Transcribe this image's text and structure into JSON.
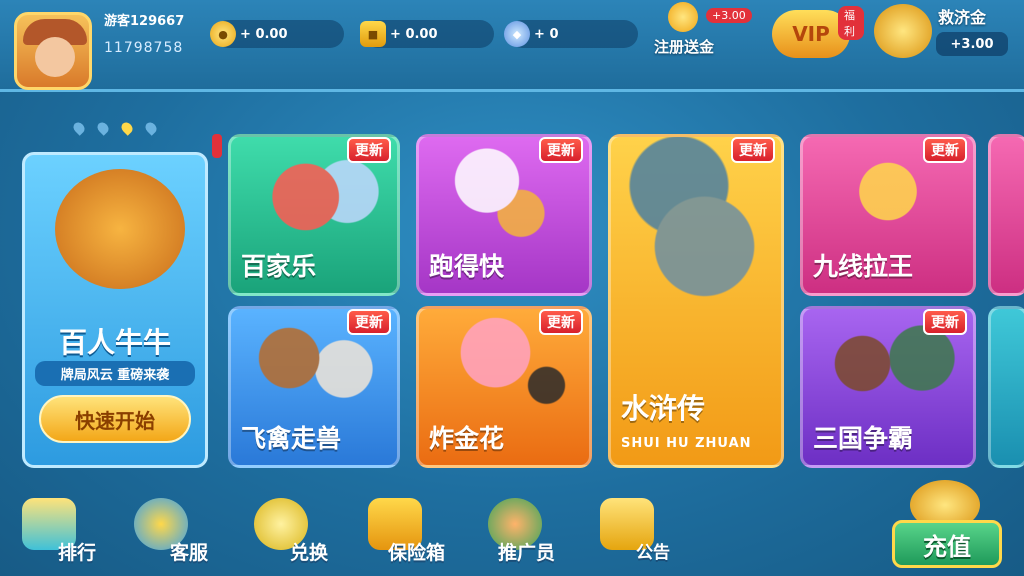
{
  "user": {
    "name": "游客129667",
    "id": "11798758"
  },
  "currency": [
    {
      "icon": "gold-coin-icon",
      "prefix": "+",
      "value": "0.00"
    },
    {
      "icon": "gold-box-icon",
      "prefix": "+",
      "value": "0.00"
    },
    {
      "icon": "gem-icon",
      "prefix": "+",
      "value": "0"
    }
  ],
  "register_gift": {
    "label": "注册送金",
    "badge": "+3.00"
  },
  "vip": {
    "label": "VIP",
    "badge": "福利"
  },
  "relief": {
    "label": "救济金",
    "amount": "+3.00"
  },
  "featured": {
    "title": "百人牛牛",
    "subtitle": "牌局风云 重磅来袭",
    "button": "快速开始"
  },
  "update_badge": "更新",
  "games": [
    {
      "name": "百家乐",
      "color": "#2ec79a"
    },
    {
      "name": "跑得快",
      "color": "#c84bd8"
    },
    {
      "name": "水浒传",
      "sub": "SHUI HU ZHUAN",
      "color": "#f2b127"
    },
    {
      "name": "九线拉王",
      "color": "#e44b9c"
    },
    {
      "name": "飞禽走兽",
      "color": "#3b8ee6"
    },
    {
      "name": "炸金花",
      "color": "#f28a1e"
    },
    {
      "name": "三国争霸",
      "color": "#8d4ad8"
    }
  ],
  "nav": [
    {
      "label": "排行",
      "icon": "podium-icon"
    },
    {
      "label": "客服",
      "icon": "headset-icon"
    },
    {
      "label": "兑换",
      "icon": "exchange-icon"
    },
    {
      "label": "保险箱",
      "icon": "safe-icon"
    },
    {
      "label": "推广员",
      "icon": "money-bag-icon"
    },
    {
      "label": "公告",
      "icon": "notice-icon"
    }
  ],
  "recharge": {
    "label": "充值"
  }
}
